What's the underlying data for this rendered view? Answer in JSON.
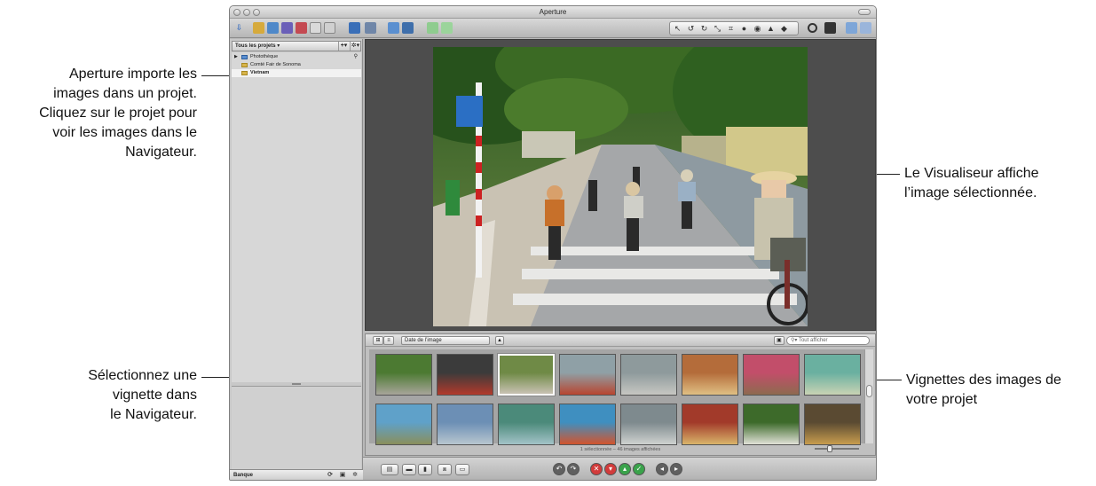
{
  "window": {
    "title": "Aperture"
  },
  "projects_panel": {
    "header_label": "Tous les projets ▾",
    "add_label": "+▾",
    "action_label": "✲▾",
    "items": [
      {
        "label": "Photothèque",
        "icon": "library-icon"
      },
      {
        "label": "Comté Fair de Sonoma",
        "icon": "folder-icon"
      },
      {
        "label": "Vietnam",
        "icon": "folder-icon",
        "selected": true
      }
    ],
    "footer_label": "Banque"
  },
  "browser": {
    "sort_label": "Date de l’image",
    "search_placeholder": "Tout afficher",
    "status": "1 sélectionnée – 46 images affichées",
    "selected_index": 2
  },
  "callouts": {
    "import": [
      "Aperture importe les",
      "images dans un projet.",
      "Cliquez sur le projet pour",
      "voir les images dans le",
      "Navigateur."
    ],
    "select": [
      "Sélectionnez une",
      "vignette dans",
      "le Navigateur."
    ],
    "viewer": [
      "Le Visualiseur affiche",
      "l’image sélectionnée."
    ],
    "thumbs": [
      "Vignettes des images de",
      "votre projet"
    ]
  },
  "colors": {
    "selection": "#f2f2f2",
    "viewer_bg": "#4d4d4d"
  }
}
